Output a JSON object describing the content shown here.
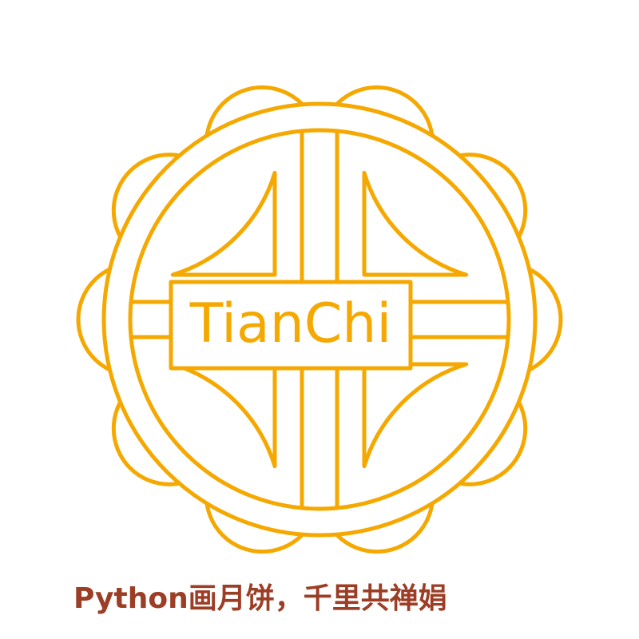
{
  "logo_text": "TianChi",
  "caption": "Python画月饼，千里共禅娟",
  "colors": {
    "stroke": "#F5A800",
    "caption": "#9C3D26",
    "background": "#FFFFFF"
  }
}
